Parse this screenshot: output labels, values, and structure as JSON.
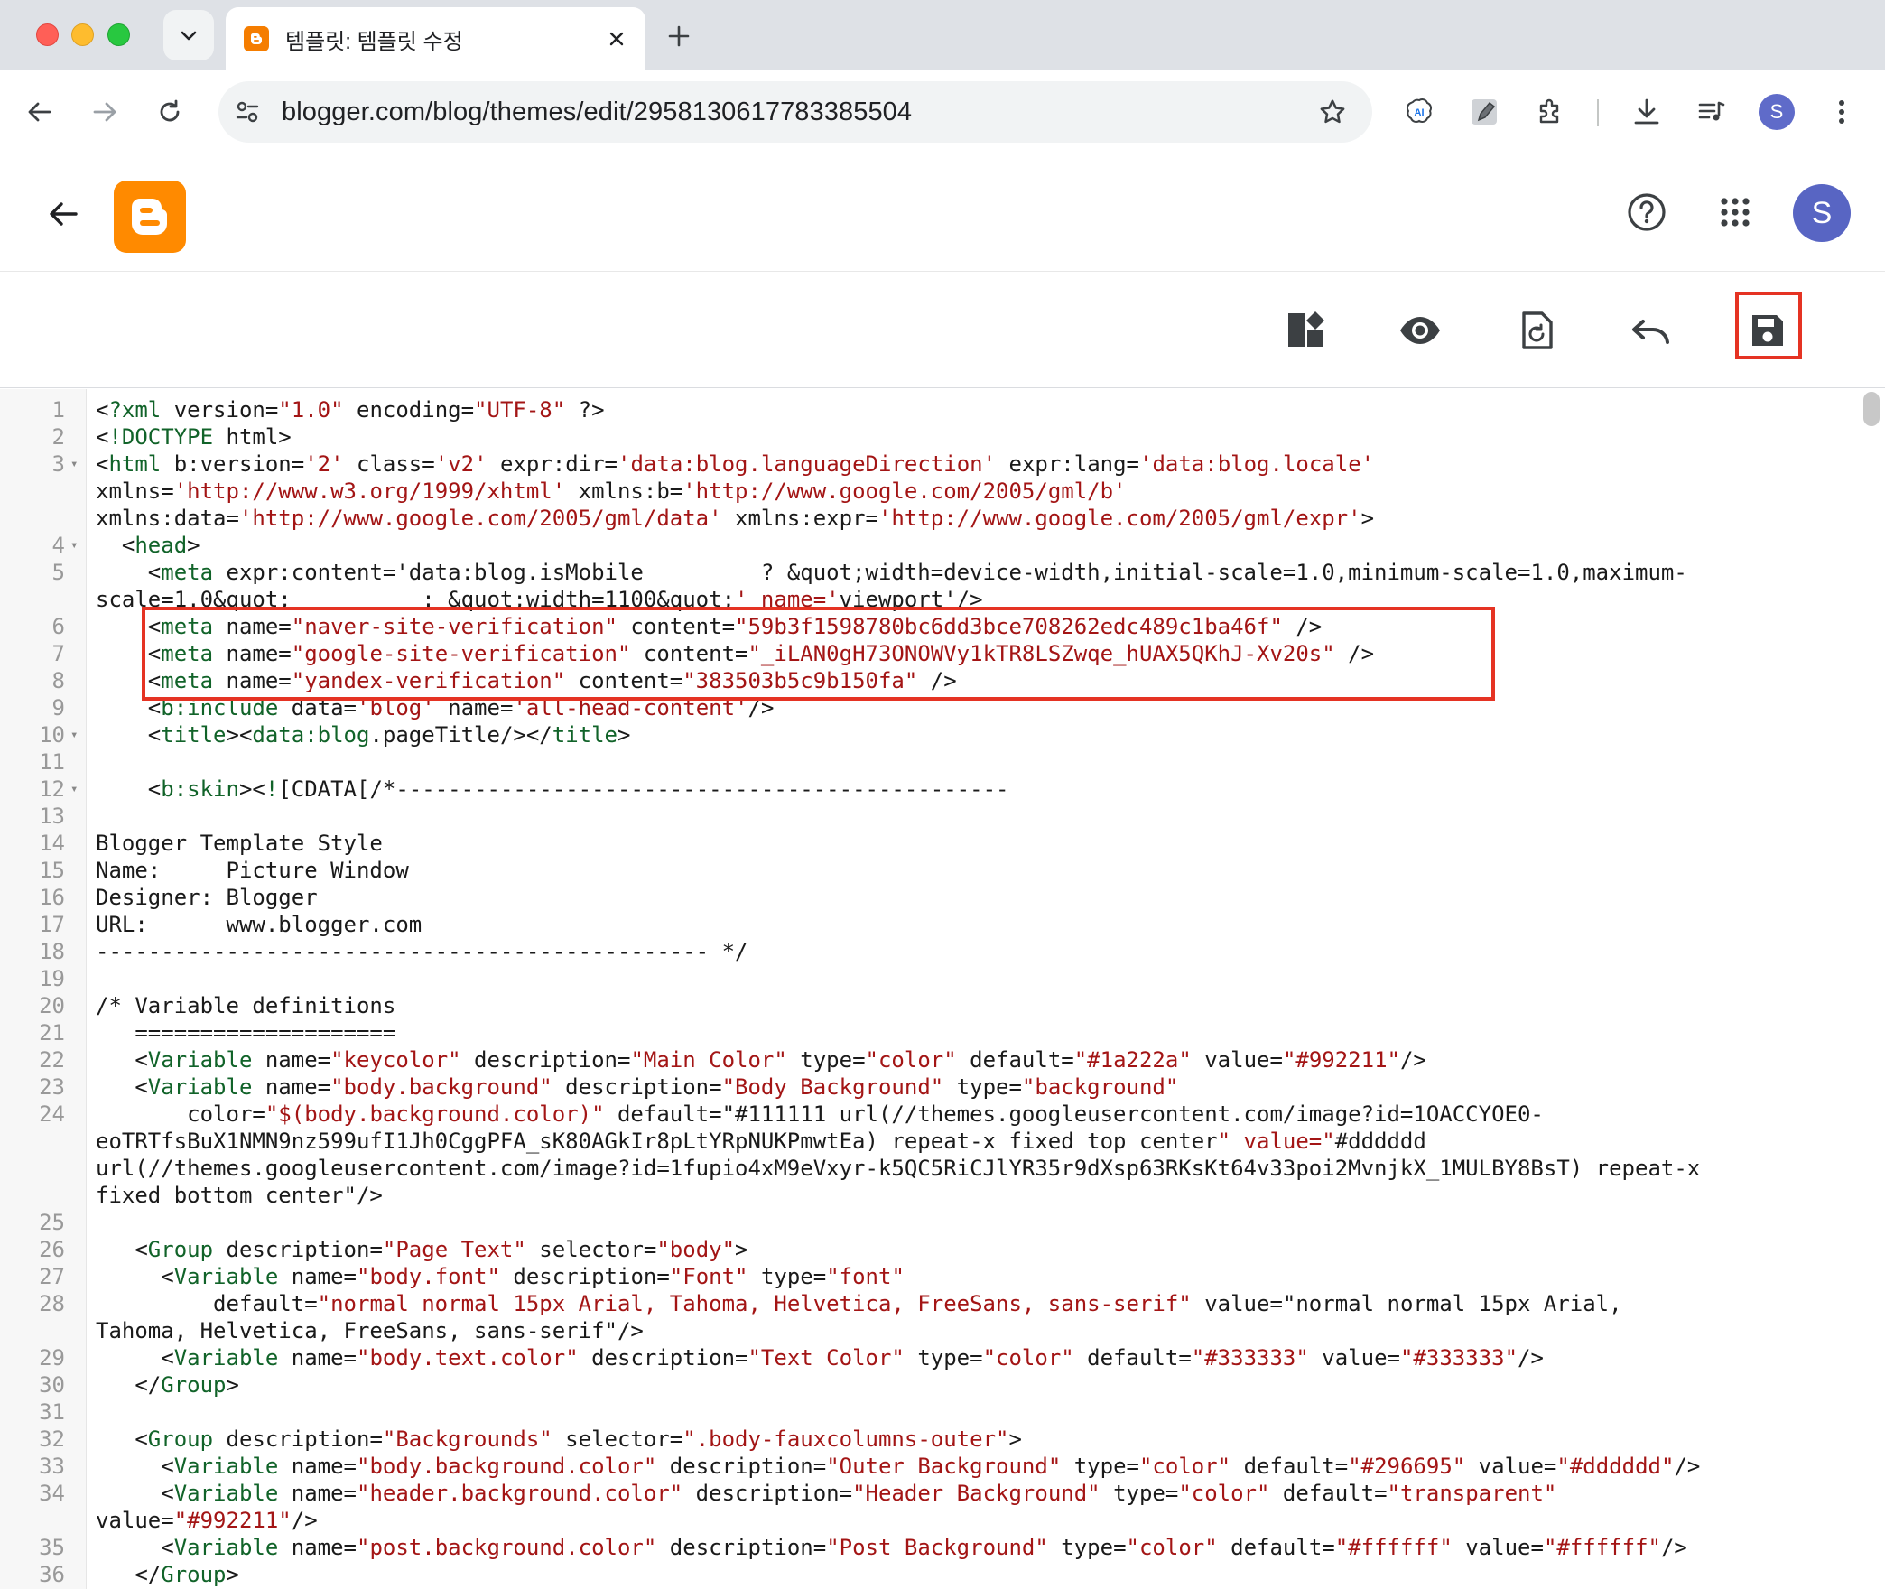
{
  "browser": {
    "tab_title": "템플릿: 템플릿 수정",
    "url": "blogger.com/blog/themes/edit/2958130617783385504",
    "profile_initial": "S"
  },
  "app": {
    "avatar_initial": "S"
  },
  "editor": {
    "lines": [
      {
        "n": "1",
        "fold": "",
        "text": "<?xml version=\"1.0\" encoding=\"UTF-8\" ?>"
      },
      {
        "n": "2",
        "fold": "",
        "text": "<!DOCTYPE html>"
      },
      {
        "n": "3",
        "fold": "▾",
        "text": "<html b:version='2' class='v2' expr:dir='data:blog.languageDirection' expr:lang='data:blog.locale'"
      },
      {
        "n": "",
        "fold": "",
        "text": "xmlns='http://www.w3.org/1999/xhtml' xmlns:b='http://www.google.com/2005/gml/b'"
      },
      {
        "n": "",
        "fold": "",
        "text": "xmlns:data='http://www.google.com/2005/gml/data' xmlns:expr='http://www.google.com/2005/gml/expr'>"
      },
      {
        "n": "4",
        "fold": "▾",
        "text": "  <head>"
      },
      {
        "n": "5",
        "fold": "",
        "text": "    <meta expr:content='data:blog.isMobile         ? &quot;width=device-width,initial-scale=1.0,minimum-scale=1.0,maximum-"
      },
      {
        "n": "",
        "fold": "",
        "text": "scale=1.0&quot;          : &quot;width=1100&quot;' name='viewport'/>"
      },
      {
        "n": "6",
        "fold": "",
        "text": "    <meta name=\"naver-site-verification\" content=\"59b3f1598780bc6dd3bce708262edc489c1ba46f\" />"
      },
      {
        "n": "7",
        "fold": "",
        "text": "    <meta name=\"google-site-verification\" content=\"_iLAN0gH73ONOWVy1kTR8LSZwqe_hUAX5QKhJ-Xv20s\" />"
      },
      {
        "n": "8",
        "fold": "",
        "text": "    <meta name=\"yandex-verification\" content=\"383503b5c9b150fa\" />"
      },
      {
        "n": "9",
        "fold": "",
        "text": "    <b:include data='blog' name='all-head-content'/>"
      },
      {
        "n": "10",
        "fold": "▾",
        "text": "    <title><data:blog.pageTitle/></title>"
      },
      {
        "n": "11",
        "fold": "",
        "text": ""
      },
      {
        "n": "12",
        "fold": "▾",
        "text": "    <b:skin><![CDATA[/*-----------------------------------------------"
      },
      {
        "n": "13",
        "fold": "",
        "text": ""
      },
      {
        "n": "14",
        "fold": "",
        "text": "Blogger Template Style"
      },
      {
        "n": "15",
        "fold": "",
        "text": "Name:     Picture Window"
      },
      {
        "n": "16",
        "fold": "",
        "text": "Designer: Blogger"
      },
      {
        "n": "17",
        "fold": "",
        "text": "URL:      www.blogger.com"
      },
      {
        "n": "18",
        "fold": "",
        "text": "----------------------------------------------- */"
      },
      {
        "n": "19",
        "fold": "",
        "text": ""
      },
      {
        "n": "20",
        "fold": "",
        "text": "/* Variable definitions"
      },
      {
        "n": "21",
        "fold": "",
        "text": "   ===================="
      },
      {
        "n": "22",
        "fold": "",
        "text": "   <Variable name=\"keycolor\" description=\"Main Color\" type=\"color\" default=\"#1a222a\" value=\"#992211\"/>"
      },
      {
        "n": "23",
        "fold": "",
        "text": "   <Variable name=\"body.background\" description=\"Body Background\" type=\"background\""
      },
      {
        "n": "24",
        "fold": "",
        "text": "       color=\"$(body.background.color)\" default=\"#111111 url(//themes.googleusercontent.com/image?id=1OACCYOE0-"
      },
      {
        "n": "",
        "fold": "",
        "text": "eoTRTfsBuX1NMN9nz599ufI1Jh0CggPFA_sK80AGkIr8pLtYRpNUKPmwtEa) repeat-x fixed top center\" value=\"#dddddd"
      },
      {
        "n": "",
        "fold": "",
        "text": "url(//themes.googleusercontent.com/image?id=1fupio4xM9eVxyr-k5QC5RiCJlYR35r9dXsp63RKsKt64v33poi2MvnjkX_1MULBY8BsT) repeat-x"
      },
      {
        "n": "",
        "fold": "",
        "text": "fixed bottom center\"/>"
      },
      {
        "n": "25",
        "fold": "",
        "text": ""
      },
      {
        "n": "26",
        "fold": "",
        "text": "   <Group description=\"Page Text\" selector=\"body\">"
      },
      {
        "n": "27",
        "fold": "",
        "text": "     <Variable name=\"body.font\" description=\"Font\" type=\"font\""
      },
      {
        "n": "28",
        "fold": "",
        "text": "         default=\"normal normal 15px Arial, Tahoma, Helvetica, FreeSans, sans-serif\" value=\"normal normal 15px Arial,"
      },
      {
        "n": "",
        "fold": "",
        "text": "Tahoma, Helvetica, FreeSans, sans-serif\"/>"
      },
      {
        "n": "29",
        "fold": "",
        "text": "     <Variable name=\"body.text.color\" description=\"Text Color\" type=\"color\" default=\"#333333\" value=\"#333333\"/>"
      },
      {
        "n": "30",
        "fold": "",
        "text": "   </Group>"
      },
      {
        "n": "31",
        "fold": "",
        "text": ""
      },
      {
        "n": "32",
        "fold": "",
        "text": "   <Group description=\"Backgrounds\" selector=\".body-fauxcolumns-outer\">"
      },
      {
        "n": "33",
        "fold": "",
        "text": "     <Variable name=\"body.background.color\" description=\"Outer Background\" type=\"color\" default=\"#296695\" value=\"#dddddd\"/>"
      },
      {
        "n": "34",
        "fold": "",
        "text": "     <Variable name=\"header.background.color\" description=\"Header Background\" type=\"color\" default=\"transparent\""
      },
      {
        "n": "",
        "fold": "",
        "text": "value=\"#992211\"/>"
      },
      {
        "n": "35",
        "fold": "",
        "text": "     <Variable name=\"post.background.color\" description=\"Post Background\" type=\"color\" default=\"#ffffff\" value=\"#ffffff\"/>"
      },
      {
        "n": "36",
        "fold": "",
        "text": "   </Group>"
      }
    ]
  }
}
